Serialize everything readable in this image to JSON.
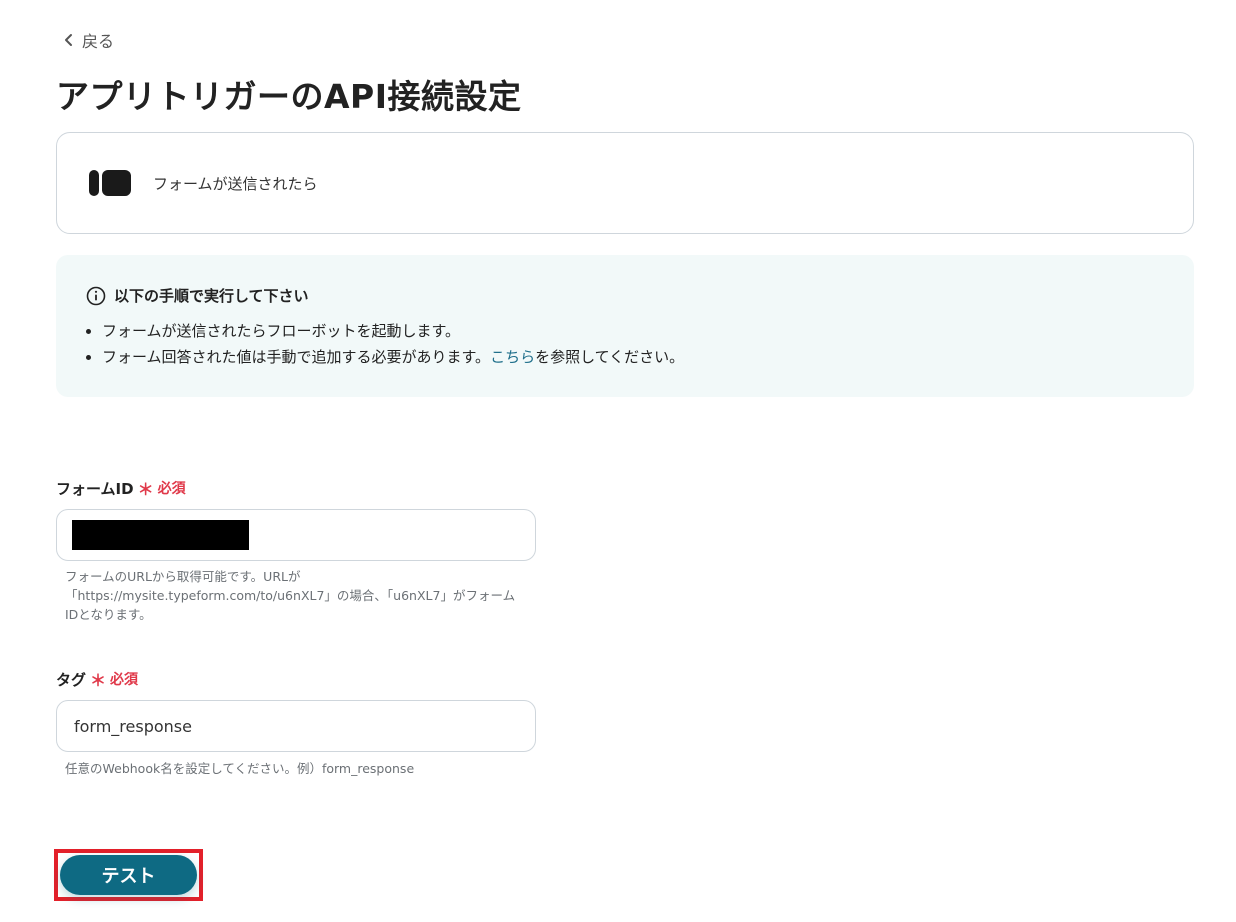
{
  "nav": {
    "back_label": "戻る"
  },
  "page": {
    "title": "アプリトリガーのAPI接続設定"
  },
  "app_card": {
    "trigger_label": "フォームが送信されたら",
    "icon": "typeform-logo-icon"
  },
  "info": {
    "title": "以下の手順で実行して下さい",
    "items": [
      {
        "text": "フォームが送信されたらフローボットを起動します。"
      },
      {
        "text_before": "フォーム回答された値は手動で追加する必要があります。",
        "link": "こちら",
        "text_after": "を参照してください。"
      }
    ]
  },
  "form": {
    "form_id": {
      "label": "フォームID",
      "required_mark": "＊",
      "required_text": "必須",
      "value": "",
      "help_lines": [
        "フォームのURLから取得可能です。URLが",
        "「https://mysite.typeform.com/to/u6nXL7」の場合、「u6nXL7」がフォーム",
        "IDとなります。"
      ]
    },
    "tag": {
      "label": "タグ",
      "required_mark": "＊",
      "required_text": "必須",
      "value": "form_response",
      "help": "任意のWebhook名を設定してください。例）form_response"
    }
  },
  "actions": {
    "test_label": "テスト"
  },
  "colors": {
    "accent": "#0e6a83",
    "required": "#e0394a",
    "highlight": "#e3202a",
    "info_bg": "#f2f9f9"
  }
}
